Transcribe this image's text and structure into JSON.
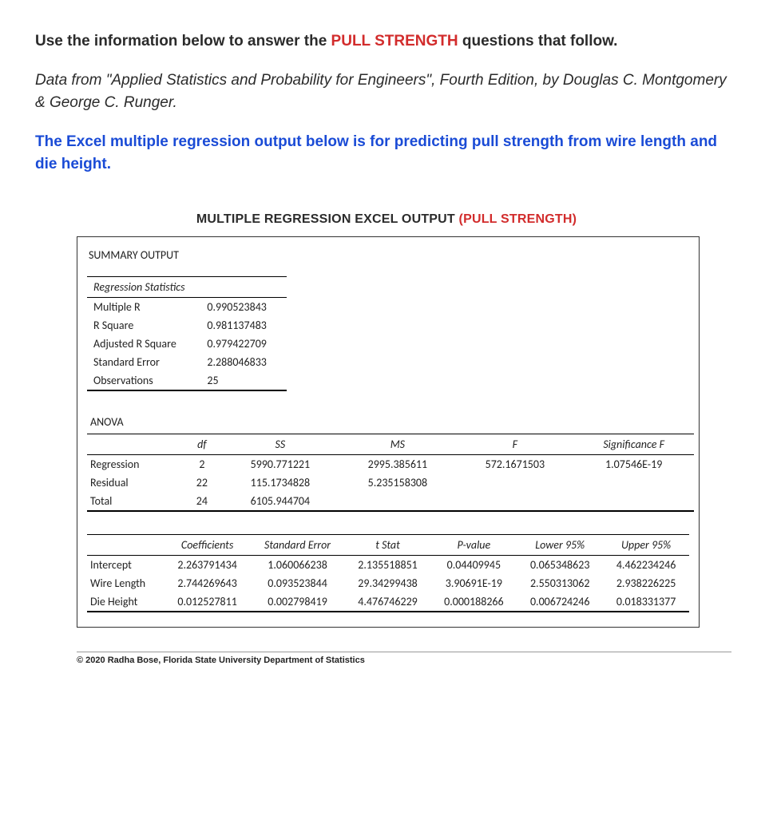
{
  "intro": {
    "line1_prefix": "Use the information below to answer the ",
    "line1_highlight": "PULL STRENGTH",
    "line1_suffix": " questions that follow.",
    "line2": "Data from \"Applied Statistics and Probability for Engineers\", Fourth Edition, by Douglas C. Montgomery & George C. Runger.",
    "line3": "The Excel multiple regression output below is for predicting pull strength from wire length and die height."
  },
  "output_title": {
    "prefix": "MULTIPLE REGRESSION EXCEL OUTPUT ",
    "highlight": "(PULL STRENGTH)"
  },
  "summary_label": "SUMMARY OUTPUT",
  "regstats_header": "Regression Statistics",
  "regstats": [
    {
      "label": "Multiple R",
      "value": "0.990523843"
    },
    {
      "label": "R Square",
      "value": "0.981137483"
    },
    {
      "label": "Adjusted R Square",
      "value": "0.979422709"
    },
    {
      "label": "Standard Error",
      "value": "2.288046833"
    },
    {
      "label": "Observations",
      "value": "25"
    }
  ],
  "anova_label": "ANOVA",
  "anova_headers": {
    "df": "df",
    "ss": "SS",
    "ms": "MS",
    "f": "F",
    "sigf": "Significance F"
  },
  "anova_rows": [
    {
      "label": "Regression",
      "df": "2",
      "ss": "5990.771221",
      "ms": "2995.385611",
      "f": "572.1671503",
      "sigf": "1.07546E-19"
    },
    {
      "label": "Residual",
      "df": "22",
      "ss": "115.1734828",
      "ms": "5.235158308",
      "f": "",
      "sigf": ""
    },
    {
      "label": "Total",
      "df": "24",
      "ss": "6105.944704",
      "ms": "",
      "f": "",
      "sigf": ""
    }
  ],
  "coef_headers": {
    "coef": "Coefficients",
    "se": "Standard Error",
    "t": "t Stat",
    "p": "P-value",
    "lo": "Lower 95%",
    "hi": "Upper 95%"
  },
  "coef_rows": [
    {
      "label": "Intercept",
      "coef": "2.263791434",
      "se": "1.060066238",
      "t": "2.135518851",
      "p": "0.04409945",
      "lo": "0.065348623",
      "hi": "4.462234246"
    },
    {
      "label": "Wire Length",
      "coef": "2.744269643",
      "se": "0.093523844",
      "t": "29.34299438",
      "p": "3.90691E-19",
      "lo": "2.550313062",
      "hi": "2.938226225"
    },
    {
      "label": "Die Height",
      "coef": "0.012527811",
      "se": "0.002798419",
      "t": "4.476746229",
      "p": "0.000188266",
      "lo": "0.006724246",
      "hi": "0.018331377"
    }
  ],
  "copyright": "© 2020 Radha Bose, Florida State University Department of Statistics",
  "chart_data": {
    "type": "table",
    "title": "Multiple Regression Excel Output (Pull Strength)",
    "regression_statistics": {
      "Multiple R": 0.990523843,
      "R Square": 0.981137483,
      "Adjusted R Square": 0.979422709,
      "Standard Error": 2.288046833,
      "Observations": 25
    },
    "anova": [
      {
        "source": "Regression",
        "df": 2,
        "SS": 5990.771221,
        "MS": 2995.385611,
        "F": 572.1671503,
        "Significance F": 1.07546e-19
      },
      {
        "source": "Residual",
        "df": 22,
        "SS": 115.1734828,
        "MS": 5.235158308
      },
      {
        "source": "Total",
        "df": 24,
        "SS": 6105.944704
      }
    ],
    "coefficients": [
      {
        "term": "Intercept",
        "Coefficient": 2.263791434,
        "Standard Error": 1.060066238,
        "t Stat": 2.135518851,
        "P-value": 0.04409945,
        "Lower 95%": 0.065348623,
        "Upper 95%": 4.462234246
      },
      {
        "term": "Wire Length",
        "Coefficient": 2.744269643,
        "Standard Error": 0.093523844,
        "t Stat": 29.34299438,
        "P-value": 3.90691e-19,
        "Lower 95%": 2.550313062,
        "Upper 95%": 2.938226225
      },
      {
        "term": "Die Height",
        "Coefficient": 0.012527811,
        "Standard Error": 0.002798419,
        "t Stat": 4.476746229,
        "P-value": 0.000188266,
        "Lower 95%": 0.006724246,
        "Upper 95%": 0.018331377
      }
    ]
  }
}
